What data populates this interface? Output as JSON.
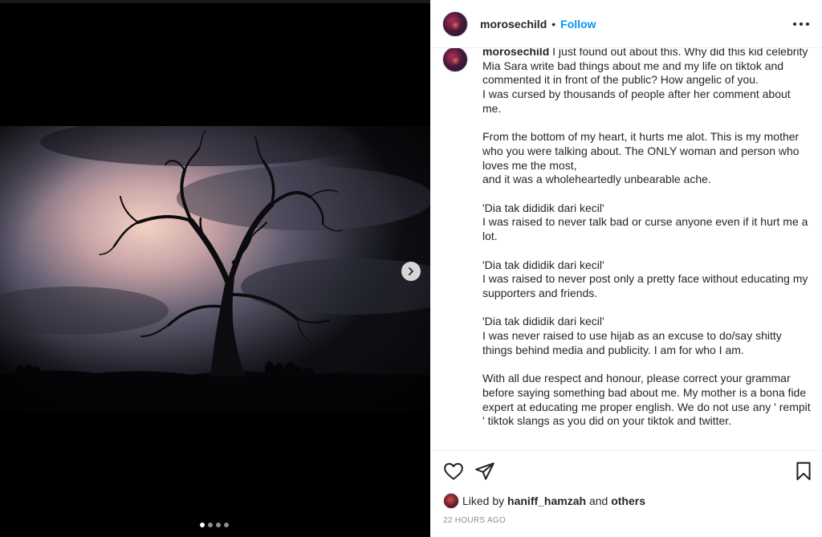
{
  "post": {
    "username": "morosechild",
    "separator": "•",
    "follow_label": "Follow",
    "more_icon": "more-options-icon",
    "next_icon": "chevron-right-icon",
    "carousel": {
      "count": 4,
      "active_index": 0
    }
  },
  "caption": {
    "username": "morosechild",
    "lines": [
      "I just found out about this. Why did this kid celebrity Mia Sara write bad things about me and my life on tiktok and commented it in front of the public? How angelic of you.",
      "I was cursed by thousands of people after her comment about me.",
      "",
      "From the bottom of my heart, it hurts me alot. This is my mother who you were talking about. The ONLY woman and person who loves me the most,",
      "and it was a wholeheartedly unbearable ache.",
      "",
      "'Dia tak dididik dari kecil'",
      "I was raised to never talk bad or curse anyone even if it hurt me a lot.",
      "",
      "'Dia tak dididik dari kecil'",
      "I was raised to never post only a pretty face without educating my supporters and friends.",
      "",
      "'Dia tak dididik dari kecil'",
      "I was never raised to use hijab as an excuse to do/say shitty things behind media and publicity. I am for who I am.",
      "",
      "With all due respect and honour, please correct your grammar before saying something bad about me. My mother is a bona fide expert at educating me proper english. We do not use any ' rempit ' tiktok slangs as you did on your tiktok and twitter."
    ]
  },
  "likes": {
    "prefix": "Liked by",
    "user": "haniff_hamzah",
    "conjunction": "and",
    "others": "others"
  },
  "timestamp": "22 HOURS AGO",
  "icons": {
    "like": "heart-icon",
    "share": "paper-plane-icon",
    "save": "bookmark-icon"
  }
}
